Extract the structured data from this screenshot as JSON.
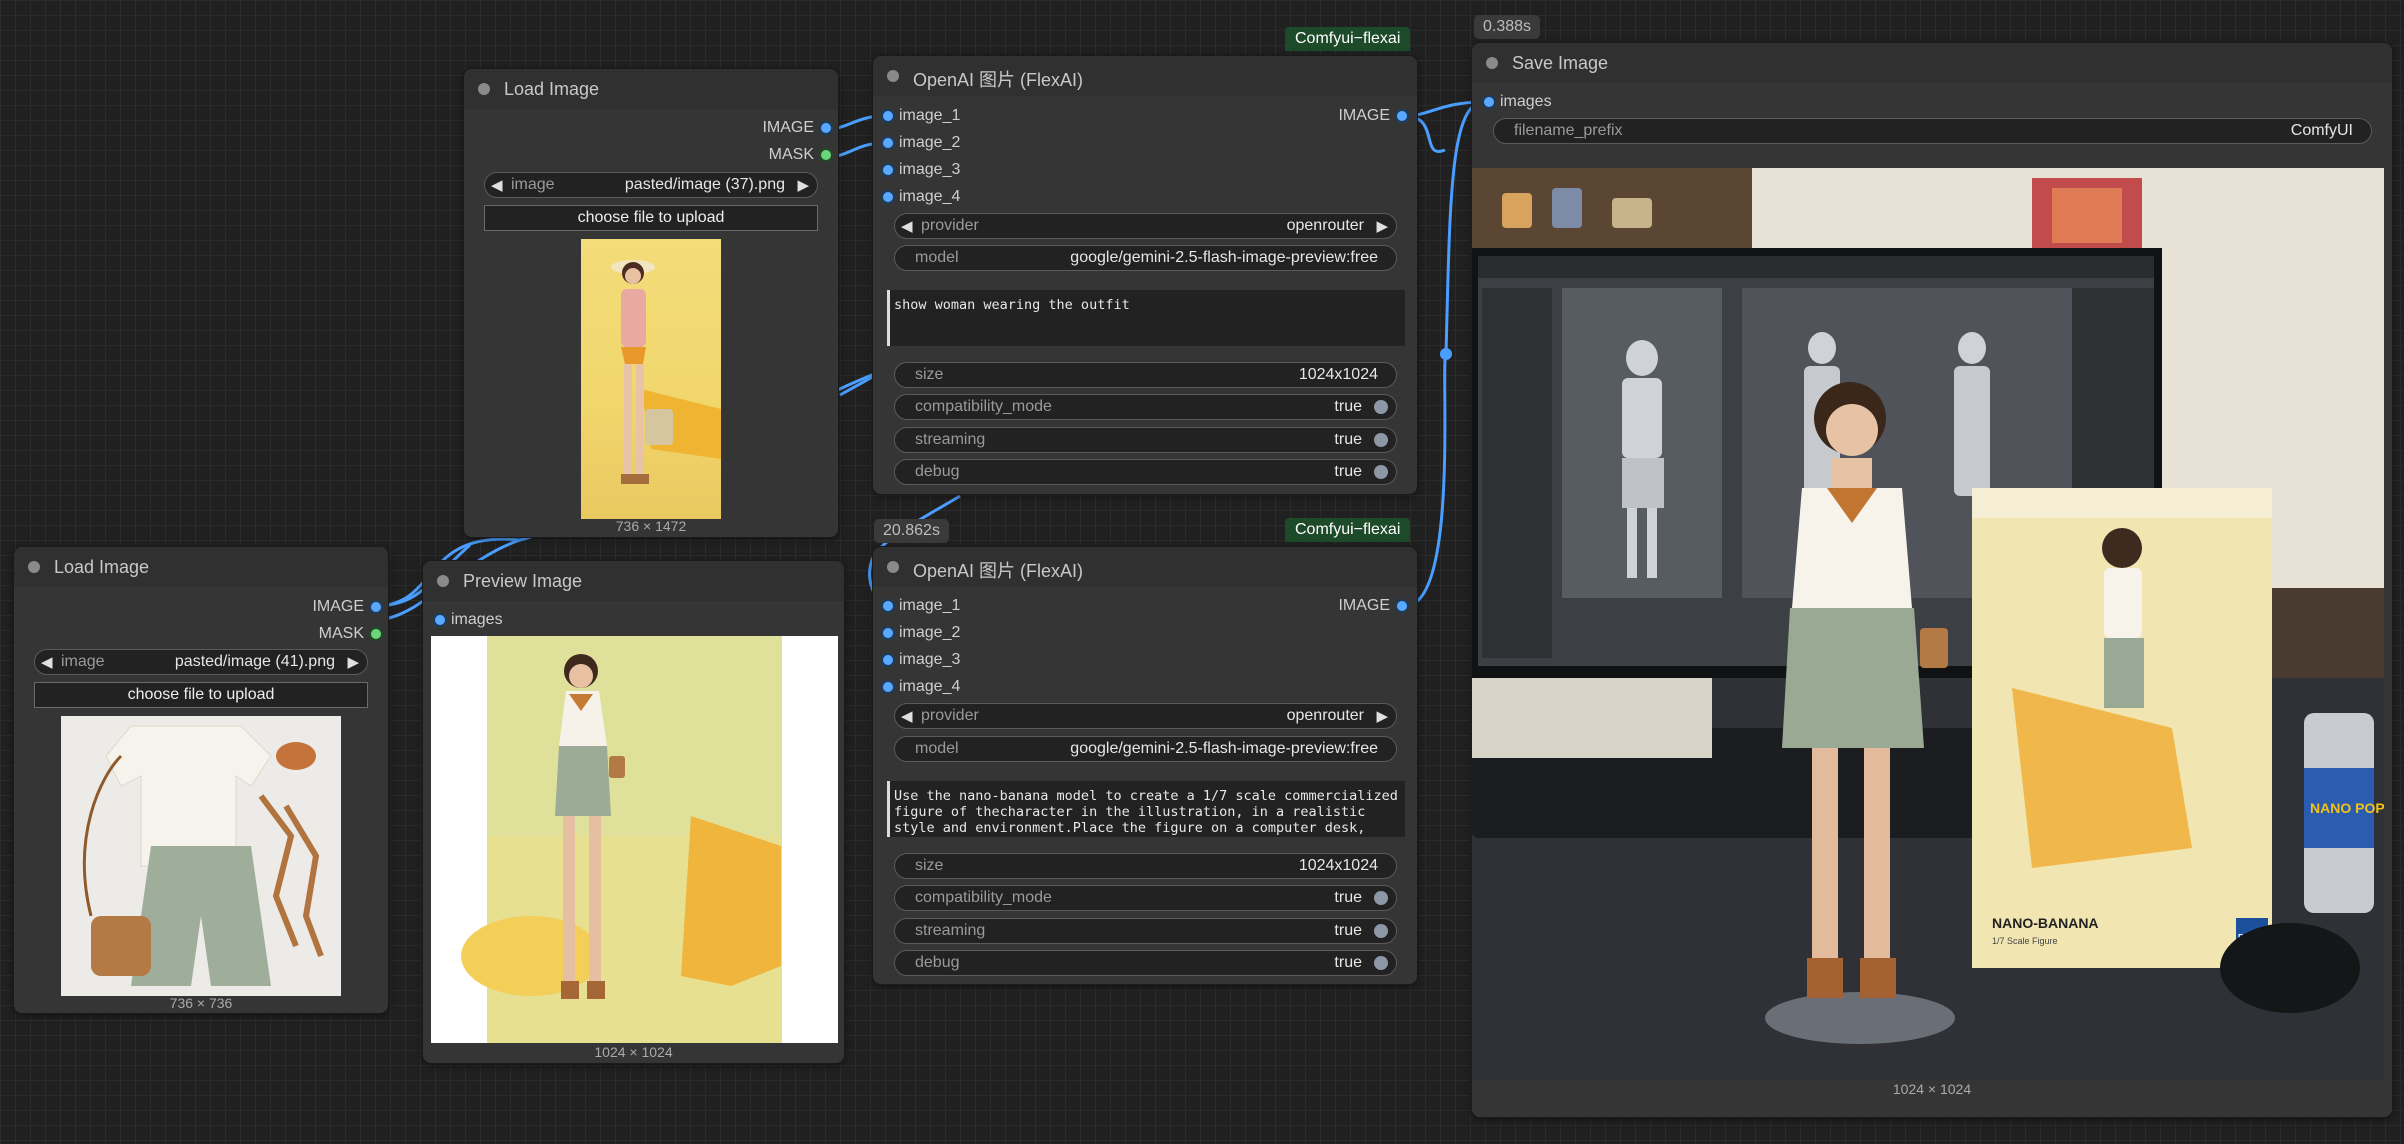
{
  "nodes": {
    "load_image_1": {
      "title": "Load Image",
      "outputs": [
        "IMAGE",
        "MASK"
      ],
      "image_label": "image",
      "image_value": "pasted/image (37).png",
      "upload_label": "choose file to upload",
      "dims": "736 × 1472"
    },
    "load_image_2": {
      "title": "Load Image",
      "outputs": [
        "IMAGE",
        "MASK"
      ],
      "image_label": "image",
      "image_value": "pasted/image (41).png",
      "upload_label": "choose file to upload",
      "dims": "736 × 736"
    },
    "openai_1": {
      "badge": "Comfyui−flexai",
      "title": "OpenAI 图片 (FlexAI)",
      "inputs": [
        "image_1",
        "image_2",
        "image_3",
        "image_4"
      ],
      "output": "IMAGE",
      "provider_label": "provider",
      "provider_value": "openrouter",
      "model_label": "model",
      "model_value": "google/gemini-2.5-flash-image-preview:free",
      "prompt": "show woman wearing the outfit",
      "size_label": "size",
      "size_value": "1024x1024",
      "compat_label": "compatibility_mode",
      "compat_value": "true",
      "stream_label": "streaming",
      "stream_value": "true",
      "debug_label": "debug",
      "debug_value": "true"
    },
    "openai_2": {
      "time": "20.862s",
      "badge": "Comfyui−flexai",
      "title": "OpenAI 图片 (FlexAI)",
      "inputs": [
        "image_1",
        "image_2",
        "image_3",
        "image_4"
      ],
      "output": "IMAGE",
      "provider_label": "provider",
      "provider_value": "openrouter",
      "model_label": "model",
      "model_value": "google/gemini-2.5-flash-image-preview:free",
      "prompt": "Use the nano-banana model to create a 1/7 scale commercialized figure of thecharacter in the illustration, in a realistic style and environment.Place the figure on a computer desk, using a circular transparent acrylic base",
      "size_label": "size",
      "size_value": "1024x1024",
      "compat_label": "compatibility_mode",
      "compat_value": "true",
      "stream_label": "streaming",
      "stream_value": "true",
      "debug_label": "debug",
      "debug_value": "true"
    },
    "preview": {
      "title": "Preview Image",
      "input": "images",
      "dims": "1024 × 1024"
    },
    "save": {
      "time": "0.388s",
      "title": "Save Image",
      "input": "images",
      "prefix_label": "filename_prefix",
      "prefix_value": "ComfyUI",
      "dims": "1024 × 1024",
      "monitor_text": "",
      "box_brand": "NANO-BANANA",
      "box_sub": "1/7 Scale Figure",
      "box_logo": "BAN DAI",
      "can_text": "NANO POP"
    }
  },
  "colors": {
    "wire": "#5aa8ff",
    "badge": "#1d4a28",
    "canvas": "#202020"
  }
}
